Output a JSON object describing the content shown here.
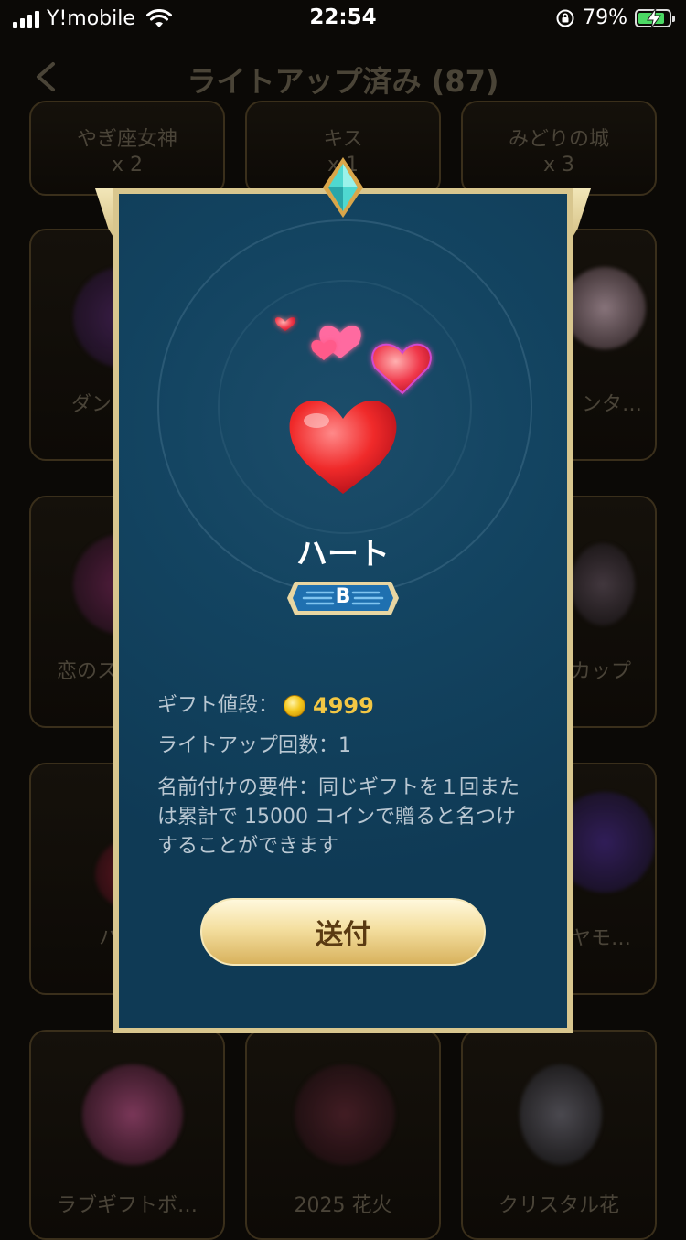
{
  "status_bar": {
    "carrier": "Y!mobile",
    "time": "22:54",
    "battery_percent": "79%",
    "battery_level": 0.79,
    "charging": true
  },
  "header": {
    "title": "ライトアップ済み (87)"
  },
  "grid": {
    "top_row": [
      {
        "name": "やぎ座女神",
        "qty": "x 2"
      },
      {
        "name": "キス",
        "qty": "x 1"
      },
      {
        "name": "みどりの城",
        "qty": "x 3"
      }
    ],
    "partial_labels": {
      "r2_left": "ダン",
      "r2_right": "ンタ…",
      "r3_left": "恋のス",
      "r3_right": "カップ",
      "r4_left": "ハ",
      "r4_right": "ヤモ…"
    },
    "bottom_row": [
      {
        "name": "ラブギフトボ…"
      },
      {
        "name": "2025 花火"
      },
      {
        "name": "クリスタル花"
      }
    ]
  },
  "modal": {
    "gift_name": "ハート",
    "rank": "B",
    "price_label": "ギフト値段：",
    "price": "4999",
    "lightup_count_label": "ライトアップ回数：1",
    "requirement": "名前付けの要件：同じギフトを１回または累計で 15000 コインで贈ると名つけすることができます",
    "send_button": "送付"
  },
  "colors": {
    "modal_bg": "#0f3a57",
    "frame_gold": "#d8c68e",
    "price_gold": "#f3c744",
    "button_text": "#5a3a12"
  }
}
